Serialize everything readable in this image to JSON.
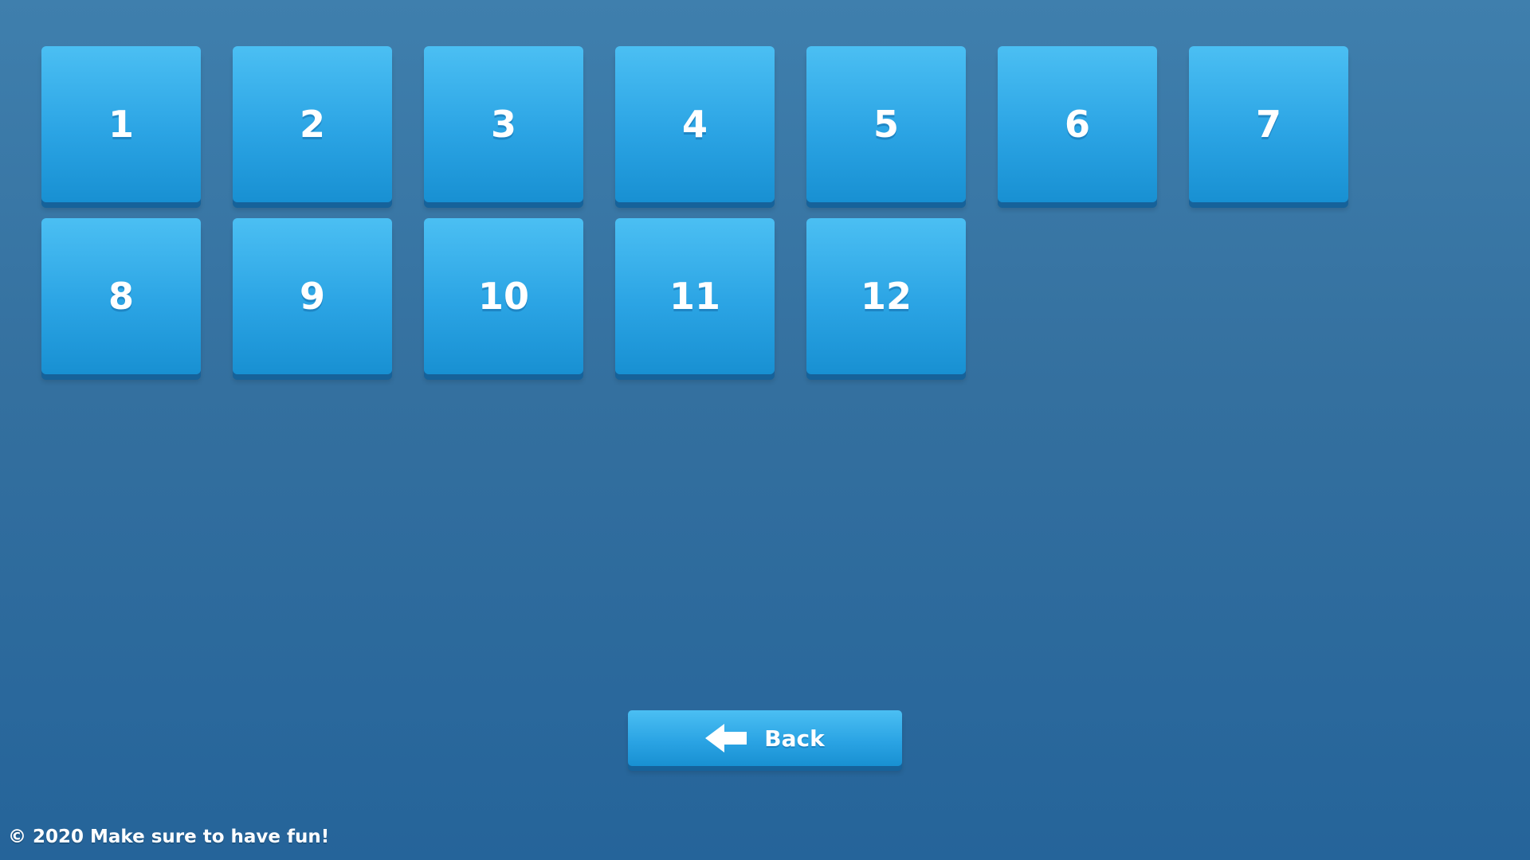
{
  "level_select": {
    "levels": [
      "1",
      "2",
      "3",
      "4",
      "5",
      "6",
      "7",
      "8",
      "9",
      "10",
      "11",
      "12"
    ]
  },
  "back_button": {
    "label": "Back",
    "icon": "arrow-left-icon"
  },
  "footer": {
    "text": "© 2020 Make sure to have fun!"
  },
  "colors": {
    "background": "#3574a3",
    "button": "#2ba4e4",
    "button_shadow": "#16629a",
    "text": "#ffffff"
  }
}
